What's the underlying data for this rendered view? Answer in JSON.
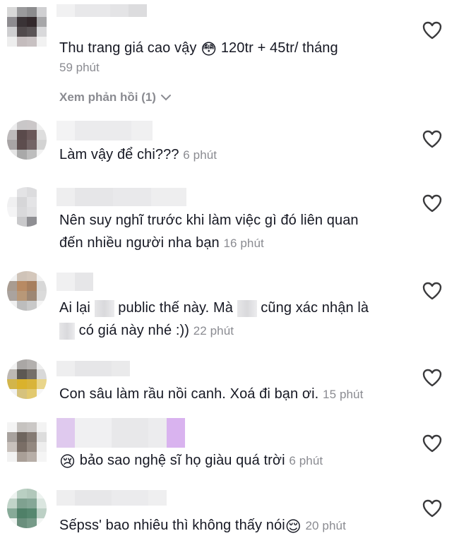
{
  "comments": [
    {
      "text": "Thu trang giá cao vậy",
      "emoji": "😳",
      "text2": "120tr + 45tr/ tháng",
      "time": "59 phút",
      "replies_label": "Xem phản hồi (1)"
    },
    {
      "text": "Làm vậy để chi???",
      "time": "6 phút"
    },
    {
      "line1": "Nên suy nghĩ trước khi làm việc gì đó liên quan",
      "line2": "đến nhiều người nha bạn",
      "time": "16 phút"
    },
    {
      "part1": "Ai lại",
      "part2": "public thế này. Mà",
      "part3": "cũng xác nhận là",
      "part4": "có giá này nhé :))",
      "time": "22 phút"
    },
    {
      "text": "Con sâu làm rầu nồi canh. Xoá đi bạn ơi.",
      "time": "15 phút"
    },
    {
      "emoji": "😢",
      "text": "bảo sao nghệ sĩ họ giàu quá trời",
      "time": "6 phút"
    },
    {
      "text": "Sếpss' bao nhiêu thì không thấy nói",
      "emoji": "😌",
      "time": "20 phút"
    }
  ],
  "icons": {
    "like": "heart-outline-icon",
    "expand": "chevron-down-icon"
  },
  "colors": {
    "timestamp": "#8a8b91",
    "text": "#161823",
    "heart": "#3a3a3c"
  }
}
